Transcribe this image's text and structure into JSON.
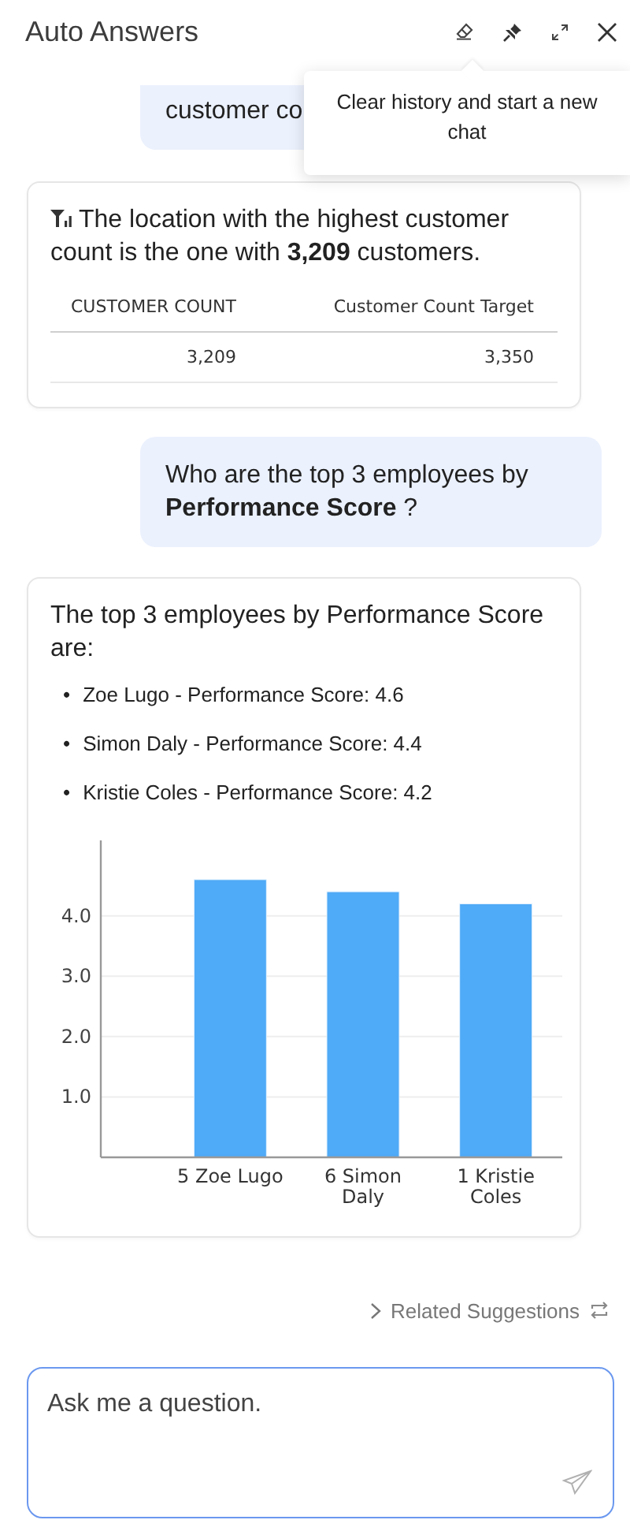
{
  "header": {
    "title": "Auto Answers"
  },
  "tooltip": {
    "text": "Clear history and start a new chat"
  },
  "messages": [
    {
      "kind": "question",
      "text": "customer co"
    },
    {
      "kind": "answer",
      "show_icon": true,
      "text": "The location with the highest customer count is the one with **3,209** customers.",
      "table": {
        "columns": [
          "CUSTOMER COUNT",
          "Customer Count Target"
        ],
        "rows": [
          [
            "3,209",
            "3,350"
          ]
        ]
      }
    },
    {
      "kind": "question",
      "text": "Who are the top 3 employees by **Performance Score** ?"
    },
    {
      "kind": "answer",
      "show_icon": false,
      "text": "The top 3 employees by Performance Score are:",
      "bullets": [
        {
          "marker": "•",
          "text": "Zoe Lugo - Performance Score: 4.6"
        },
        {
          "marker": "•",
          "text": "Simon Daly - Performance Score: 4.4"
        },
        {
          "marker": "•",
          "text": "Kristie Coles - Performance Score: 4.2"
        }
      ],
      "chart_data": {
        "type": "bar",
        "categories": [
          "5 Zoe Lugo",
          "6 Simon Daly",
          "1 Kristie Coles"
        ],
        "series": [
          {
            "color": "#4faaf7",
            "values": [
              4.6,
              4.4,
              4.2
            ]
          }
        ],
        "grid": true,
        "ylim": [
          0,
          5.25
        ],
        "yticks": [
          {
            "value": 1,
            "label": "1.0"
          },
          {
            "value": 2,
            "label": "2.0"
          },
          {
            "value": 3,
            "label": "3.0"
          },
          {
            "value": 4,
            "label": "4.0"
          }
        ]
      }
    }
  ],
  "related_suggestions": {
    "label": "Related Suggestions"
  },
  "input": {
    "placeholder": "Ask me a question."
  }
}
